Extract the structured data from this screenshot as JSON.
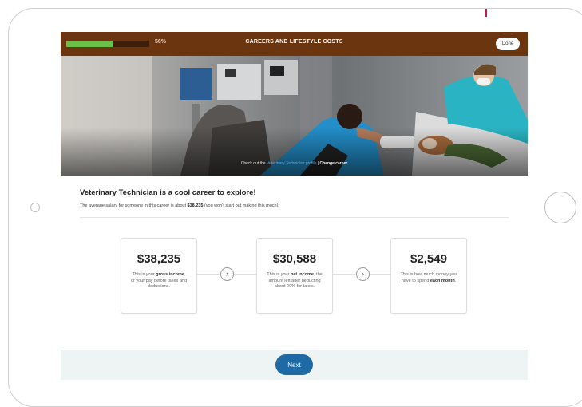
{
  "header": {
    "progress_value": 0.56,
    "progress_label": "56%",
    "title": "CAREERS AND LIFESTYLE COSTS",
    "done_label": "Done"
  },
  "hero": {
    "caption_prefix": "Check out the",
    "caption_link": "Veterinary Technician profile",
    "change_career_label": "Change career"
  },
  "main": {
    "headline": "Veterinary Technician is a cool career to explore!",
    "subline_prefix": "The average salary for someone in this career is about",
    "subline_amount": "$38,235",
    "subline_suffix": "(you won't start out making this much).",
    "cards": [
      {
        "amount": "$38,235",
        "desc_before": "This is your",
        "desc_bold": "gross income",
        "desc_after": ", or your pay before taxes and deductions."
      },
      {
        "amount": "$30,588",
        "desc_before": "This is your",
        "desc_bold": "net income",
        "desc_after": ", the amount left after deducting about 20% for taxes."
      },
      {
        "amount": "$2,549",
        "desc_before": "This is how much money you have to spend",
        "desc_bold": "each month",
        "desc_after": "."
      }
    ]
  },
  "footer": {
    "next_label": "Next"
  },
  "colors": {
    "header_bg": "#6b3510",
    "progress_fill": "#6cc04a",
    "next_button": "#1f6aa5",
    "footer_bg": "#eef3f4"
  },
  "icons": {
    "arrow": "chevron-right-icon"
  }
}
